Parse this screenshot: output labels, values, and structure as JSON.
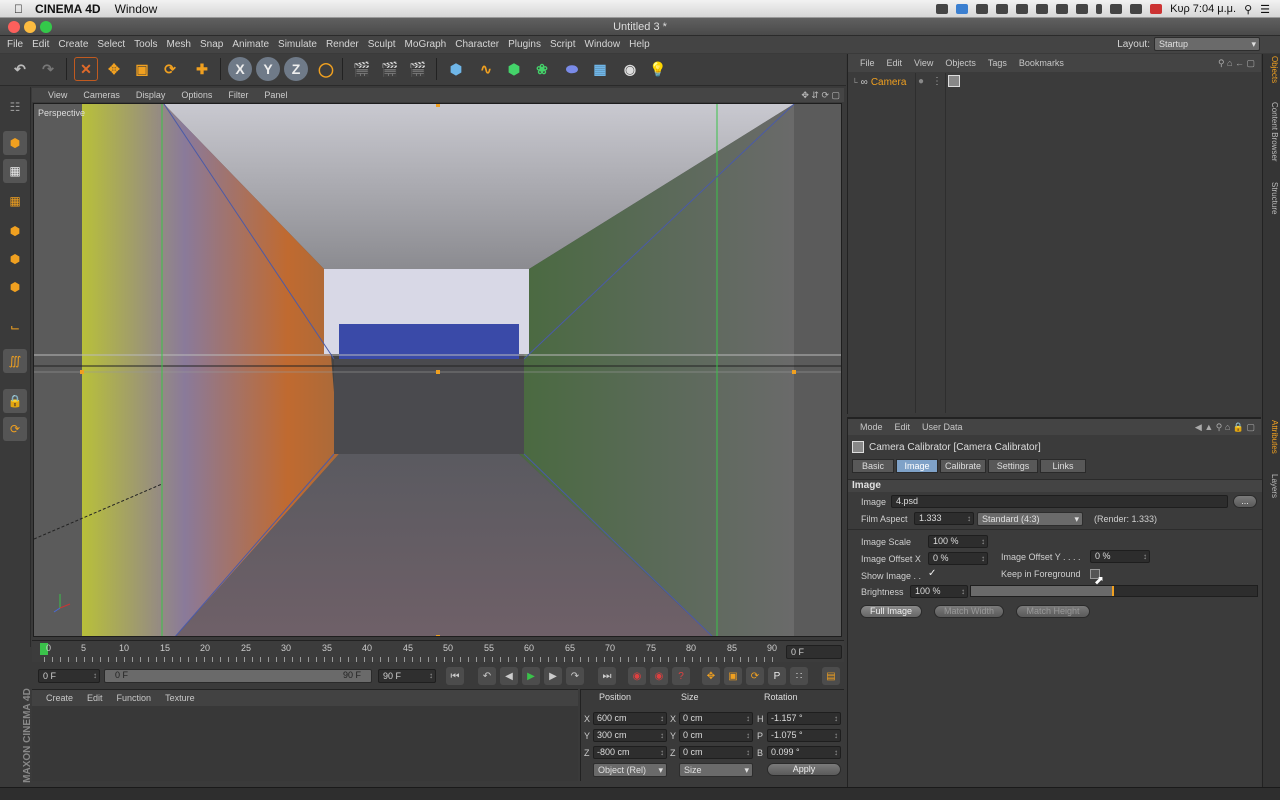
{
  "mac_menubar": {
    "app_name": "CINEMA 4D",
    "items": [
      "Window"
    ],
    "clock": "Κυρ 7:04 μ.μ."
  },
  "window_title": "Untitled 3 *",
  "c4d_menu": {
    "items": [
      "File",
      "Edit",
      "Create",
      "Select",
      "Tools",
      "Mesh",
      "Snap",
      "Animate",
      "Simulate",
      "Render",
      "Sculpt",
      "MoGraph",
      "Character",
      "Plugins",
      "Script",
      "Window",
      "Help"
    ],
    "layout_label": "Layout:",
    "layout_value": "Startup"
  },
  "viewport": {
    "menu": [
      "View",
      "Cameras",
      "Display",
      "Options",
      "Filter",
      "Panel"
    ],
    "label": "Perspective"
  },
  "timeline": {
    "ticks": [
      "0",
      "5",
      "10",
      "15",
      "20",
      "25",
      "30",
      "35",
      "40",
      "45",
      "50",
      "55",
      "60",
      "65",
      "70",
      "75",
      "80",
      "85",
      "90"
    ],
    "current_frame": "0 F"
  },
  "playback": {
    "start": "0 F",
    "range_start": "0 F",
    "range_end": "90 F",
    "end": "90 F"
  },
  "material_manager": {
    "menu": [
      "Create",
      "Edit",
      "Function",
      "Texture"
    ]
  },
  "coordinates": {
    "headers": {
      "position": "Position",
      "size": "Size",
      "rotation": "Rotation"
    },
    "rows": [
      {
        "axis": "X",
        "pos": "600 cm",
        "saxis": "X",
        "size": "0 cm",
        "raxis": "H",
        "rot": "-1.157 °"
      },
      {
        "axis": "Y",
        "pos": "300 cm",
        "saxis": "Y",
        "size": "0 cm",
        "raxis": "P",
        "rot": "-1.075 °"
      },
      {
        "axis": "Z",
        "pos": "-800 cm",
        "saxis": "Z",
        "size": "0 cm",
        "raxis": "B",
        "rot": "0.099 °"
      }
    ],
    "mode": "Object (Rel)",
    "size_mode": "Size",
    "apply": "Apply"
  },
  "object_manager": {
    "menu": [
      "File",
      "Edit",
      "View",
      "Objects",
      "Tags",
      "Bookmarks"
    ],
    "object_name": "Camera"
  },
  "attribute_manager": {
    "menu": [
      "Mode",
      "Edit",
      "User Data"
    ],
    "title": "Camera Calibrator [Camera Calibrator]",
    "tabs": [
      "Basic",
      "Image",
      "Calibrate",
      "Settings",
      "Links"
    ],
    "section": "Image",
    "image_label": "Image",
    "image_value": "4.psd",
    "browse": "...",
    "film_aspect_label": "Film Aspect",
    "film_aspect_value": "1.333",
    "film_aspect_preset": "Standard (4:3)",
    "render_note": "(Render: 1.333)",
    "image_scale_label": "Image Scale",
    "image_scale_value": "100 %",
    "offset_x_label": "Image Offset X",
    "offset_x_value": "0 %",
    "offset_y_label": "Image Offset Y . . . .",
    "offset_y_value": "0 %",
    "show_image_label": "Show Image . .",
    "show_image_check": "✓",
    "keep_fg_label": "Keep in Foreground",
    "brightness_label": "Brightness",
    "brightness_value": "100 %",
    "brightness_fraction": 0.5,
    "buttons": [
      "Full Image",
      "Match Width",
      "Match Height"
    ]
  },
  "right_strip": [
    "Objects",
    "Content Browser",
    "Structure",
    "Attributes",
    "Layers"
  ],
  "colors": {
    "accent": "#7fa2c8",
    "panel": "#3b3b3b",
    "bg": "#3a3a3a"
  }
}
